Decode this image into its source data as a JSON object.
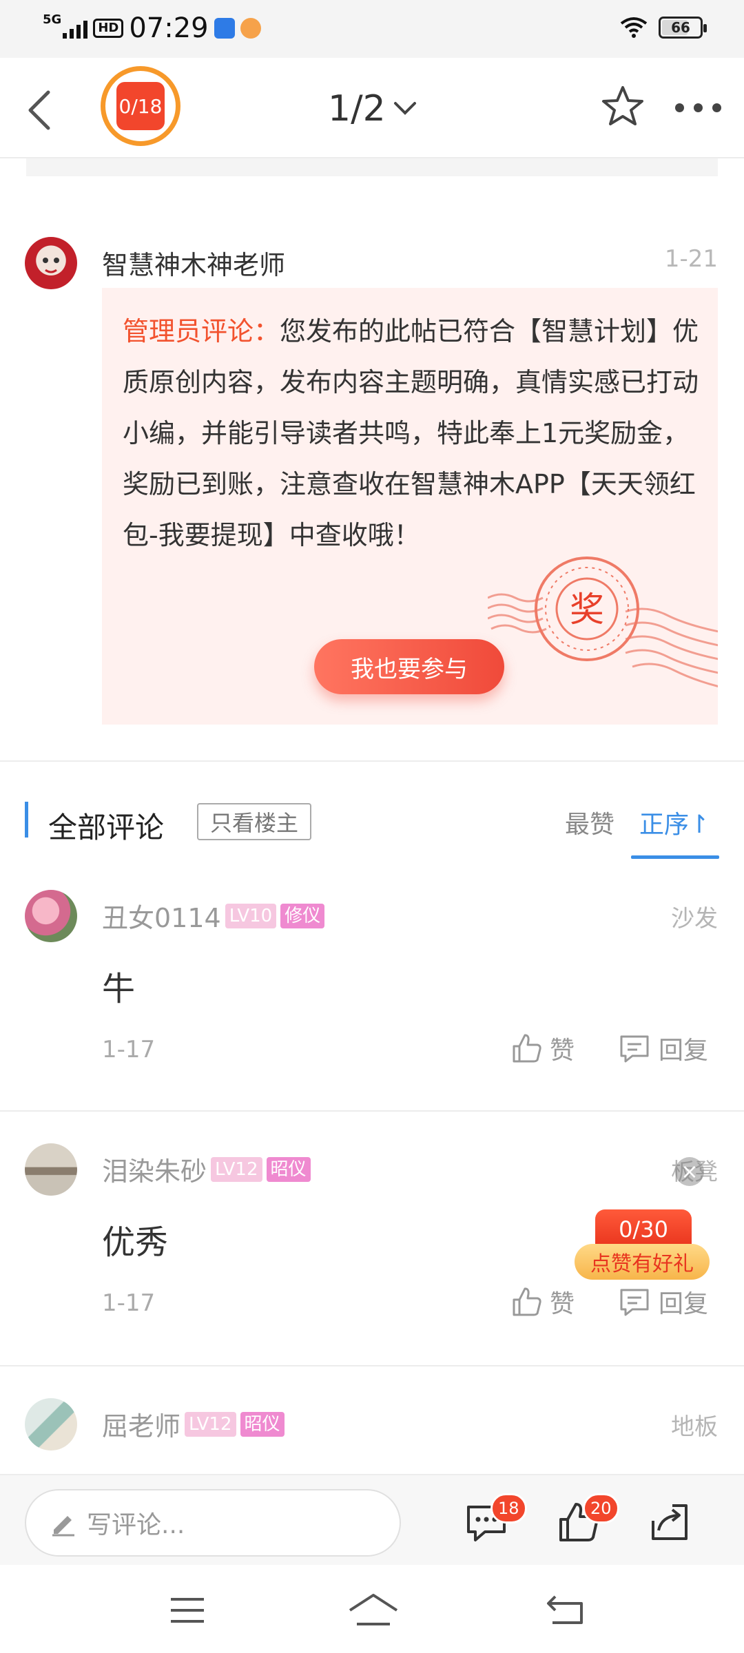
{
  "status_bar": {
    "network": "5G",
    "hd": "HD",
    "time": "07:29",
    "battery": "66"
  },
  "header": {
    "task_badge": "0/18",
    "page_indicator": "1/2"
  },
  "post": {
    "author": "智慧神木神老师",
    "date": "1-21",
    "admin_label": "管理员评论：",
    "admin_text": "您发布的此帖已符合【智慧计划】优质原创内容，发布内容主题明确，真情实感已打动小编，并能引导读者共鸣，特此奉上1元奖励金，奖励已到账，注意查收在智慧神木APP【天天领红包-我要提现】中查收哦！",
    "stamp_char": "奖",
    "join_button": "我也要参与"
  },
  "comments_header": {
    "title": "全部评论",
    "only_host": "只看楼主",
    "sort_hot": "最赞",
    "sort_order": "正序↾"
  },
  "comments": [
    {
      "name": "丑女0114",
      "level": "LV10",
      "title": "修仪",
      "floor": "沙发",
      "text": "牛",
      "date": "1-17",
      "like": "赞",
      "reply": "回复"
    },
    {
      "name": "泪染朱砂",
      "level": "LV12",
      "title": "昭仪",
      "floor": "板凳",
      "text": "优秀",
      "date": "1-17",
      "like": "赞",
      "reply": "回复"
    },
    {
      "name": "屈老师",
      "level": "LV12",
      "title": "昭仪",
      "floor": "地板"
    }
  ],
  "floating_promo": {
    "count": "0/30",
    "label": "点赞有好礼",
    "close": "×"
  },
  "bottom_bar": {
    "write_placeholder": "写评论...",
    "comment_count": "18",
    "like_count": "20"
  },
  "colors": {
    "accent": "#3a8ee6",
    "brand_red": "#f2462c",
    "admin_bg": "#fff1ef"
  }
}
